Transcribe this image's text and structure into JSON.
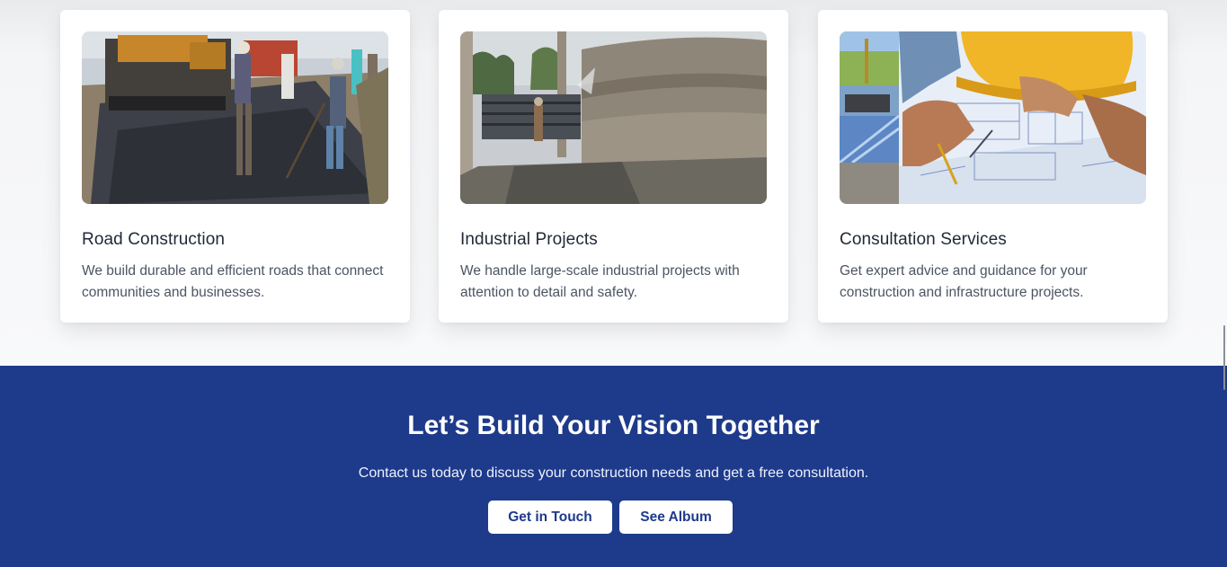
{
  "services": [
    {
      "title": "Road Construction",
      "description": "We build durable and efficient roads that connect communities and businesses.",
      "image": "road-paving-photo"
    },
    {
      "title": "Industrial Projects",
      "description": "We handle large-scale industrial projects with attention to detail and safety.",
      "image": "concrete-tank-construction-photo"
    },
    {
      "title": "Consultation Services",
      "description": "Get expert advice and guidance for your construction and infrastructure projects.",
      "image": "blueprint-planning-photo"
    }
  ],
  "cta": {
    "title": "Let’s Build Your Vision Together",
    "subtitle": "Contact us today to discuss your construction needs and get a free consultation.",
    "primary_button": "Get in Touch",
    "secondary_button": "See Album"
  },
  "colors": {
    "cta_background": "#1e3a8a",
    "card_background": "#ffffff",
    "heading_text": "#1f2937",
    "body_text": "#4b5563"
  }
}
